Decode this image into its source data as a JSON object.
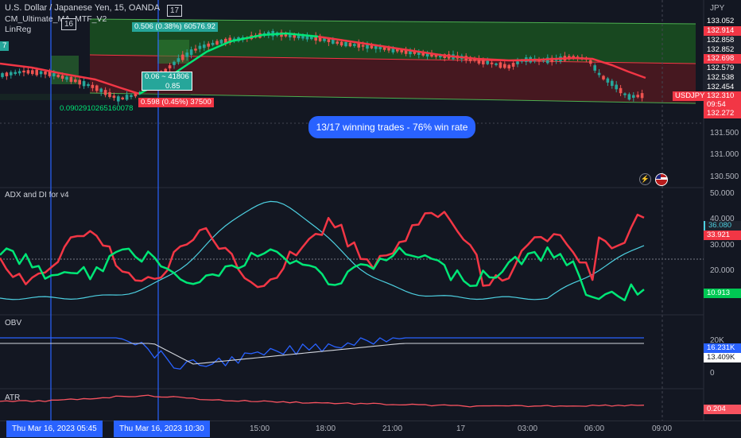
{
  "header": {
    "symbol_title": "U.S. Dollar / Japanese Yen, 15, OANDA",
    "indicator_1": "CM_Ultimate_MA_MTF_V2",
    "indicator_2": "LinReg",
    "bar_marker_1": "16",
    "bar_marker_2": "17"
  },
  "price_axis": {
    "currency": "JPY",
    "ticks": [
      "131.500",
      "131.000",
      "130.500"
    ],
    "tags": [
      {
        "label": "133.052",
        "bg": "#1e222d"
      },
      {
        "label": "132.914",
        "bg": "#f23645"
      },
      {
        "label": "132.858",
        "bg": "#1e222d"
      },
      {
        "label": "132.852",
        "bg": "#1e222d"
      },
      {
        "label": "132.698",
        "bg": "#f23645"
      },
      {
        "label": "132.579",
        "bg": "#1e222d"
      },
      {
        "label": "132.538",
        "bg": "#1e222d"
      },
      {
        "label": "132.454",
        "bg": "#1e222d"
      },
      {
        "label": "132.310",
        "bg": "#f23645"
      },
      {
        "label": "09:54",
        "bg": "#f23645"
      },
      {
        "label": "132.272",
        "bg": "#f23645"
      }
    ],
    "symbol_tag": "USDJPY"
  },
  "trade_labels": {
    "box1": "0.506 (0.38%) 60576.92",
    "box2": "0.06 ~ 41806",
    "box3": "0.85",
    "box4": "0.598 (0.45%) 37500",
    "box5": "0.0902910265160078",
    "edge_marker": "7"
  },
  "banner": "13/17 winning trades - 76% win rate",
  "adx_pane": {
    "label": "ADX and DI for v4",
    "ticks": [
      "50.000",
      "40.000",
      "30.000",
      "20.000"
    ],
    "tags": [
      {
        "label": "36.080",
        "color": "#4dd0e1"
      },
      {
        "label": "33.921",
        "color": "#f23645"
      },
      {
        "label": "10.913",
        "color": "#00e676"
      }
    ]
  },
  "obv_pane": {
    "label": "OBV",
    "ticks": [
      "20K",
      "0"
    ],
    "tags": [
      {
        "label": "16.231K",
        "color": "#2962ff"
      },
      {
        "label": "13.409K",
        "color": "#ffffff"
      }
    ]
  },
  "atr_pane": {
    "label": "ATR",
    "tag": {
      "label": "0.204",
      "color": "#f7525f"
    }
  },
  "time_axis": {
    "cursor_1": "Thu Mar 16, 2023   05:45",
    "cursor_2": "Thu Mar 16, 2023   10:30",
    "ticks": [
      "15:00",
      "18:00",
      "21:00",
      "17",
      "03:00",
      "06:00",
      "09:00"
    ]
  },
  "colors": {
    "background": "#131722",
    "bull": "#26a69a",
    "bear": "#ef5350",
    "adx": "#4dd0e1",
    "di_plus": "#00e676",
    "di_minus": "#f23645",
    "obv": "#2962ff",
    "obv_ma": "#d1d4dc",
    "atr": "#f7525f",
    "accent": "#2962ff"
  },
  "icons": [
    "lightning-icon",
    "us-flag-icon"
  ]
}
